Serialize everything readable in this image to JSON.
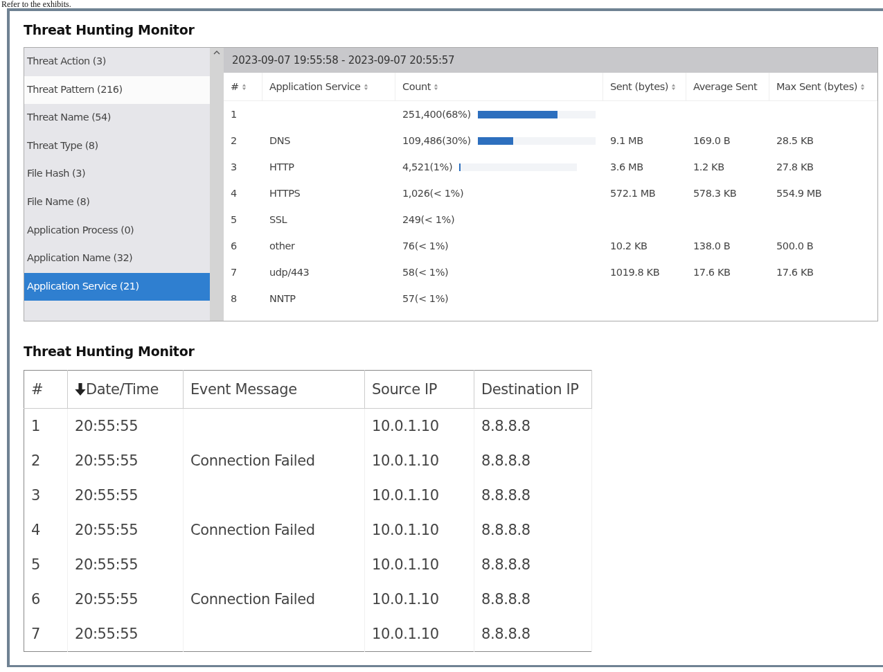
{
  "caption": "Refer to the exhibits.",
  "top_panel": {
    "title": "Threat Hunting Monitor",
    "sidebar": {
      "items": [
        {
          "label": "Threat Action (3)",
          "selected": false,
          "hovered": false
        },
        {
          "label": "Threat Pattern (216)",
          "selected": false,
          "hovered": true
        },
        {
          "label": "Threat Name (54)",
          "selected": false,
          "hovered": false
        },
        {
          "label": "Threat Type (8)",
          "selected": false,
          "hovered": false
        },
        {
          "label": "File Hash (3)",
          "selected": false,
          "hovered": false
        },
        {
          "label": "File Name (8)",
          "selected": false,
          "hovered": false
        },
        {
          "label": "Application Process (0)",
          "selected": false,
          "hovered": false
        },
        {
          "label": "Application Name (32)",
          "selected": false,
          "hovered": false
        },
        {
          "label": "Application Service (21)",
          "selected": true,
          "hovered": false
        }
      ]
    },
    "time_range": "2023-09-07 19:55:58 - 2023-09-07 20:55:57",
    "table": {
      "columns": [
        {
          "label": "#",
          "sortable": true
        },
        {
          "label": "Application Service",
          "sortable": true
        },
        {
          "label": "Count",
          "sortable": true
        },
        {
          "label": "Sent (bytes)",
          "sortable": true
        },
        {
          "label": "Average Sent",
          "sortable": false
        },
        {
          "label": "Max Sent (bytes)",
          "sortable": true
        }
      ],
      "rows": [
        {
          "num": "1",
          "service": "",
          "count": "251,400(68%)",
          "level": 0.68,
          "sent": "",
          "avg": "",
          "max": ""
        },
        {
          "num": "2",
          "service": "DNS",
          "count": "109,486(30%)",
          "level": 0.3,
          "sent": "9.1 MB",
          "avg": "169.0 B",
          "max": "28.5 KB"
        },
        {
          "num": "3",
          "service": "HTTP",
          "count": "4,521(1%)",
          "level": 0.01,
          "sent": "3.6 MB",
          "avg": "1.2 KB",
          "max": "27.8 KB"
        },
        {
          "num": "4",
          "service": "HTTPS",
          "count": "1,026(< 1%)",
          "sent": "572.1 MB",
          "avg": "578.3 KB",
          "max": "554.9 MB"
        },
        {
          "num": "5",
          "service": "SSL",
          "count": "249(< 1%)",
          "sent": "",
          "avg": "",
          "max": ""
        },
        {
          "num": "6",
          "service": "other",
          "count": "76(< 1%)",
          "sent": "10.2 KB",
          "avg": "138.0 B",
          "max": "500.0 B"
        },
        {
          "num": "7",
          "service": "udp/443",
          "count": "58(< 1%)",
          "sent": "1019.8 KB",
          "avg": "17.6 KB",
          "max": "17.6 KB"
        },
        {
          "num": "8",
          "service": "NNTP",
          "count": "57(< 1%)",
          "sent": "",
          "avg": "",
          "max": ""
        }
      ]
    }
  },
  "bottom_panel": {
    "title": "Threat Hunting Monitor",
    "table": {
      "columns": [
        {
          "label": "#",
          "sorted": false
        },
        {
          "label": "Date/Time",
          "sorted": true
        },
        {
          "label": "Event Message",
          "sorted": false
        },
        {
          "label": "Source IP",
          "sorted": false
        },
        {
          "label": "Destination IP",
          "sorted": false
        }
      ],
      "rows": [
        [
          "1",
          "20:55:55",
          "",
          "10.0.1.10",
          "8.8.8.8"
        ],
        [
          "2",
          "20:55:55",
          "Connection Failed",
          "10.0.1.10",
          "8.8.8.8"
        ],
        [
          "3",
          "20:55:55",
          "",
          "10.0.1.10",
          "8.8.8.8"
        ],
        [
          "4",
          "20:55:55",
          "Connection Failed",
          "10.0.1.10",
          "8.8.8.8"
        ],
        [
          "5",
          "20:55:55",
          "",
          "10.0.1.10",
          "8.8.8.8"
        ],
        [
          "6",
          "20:55:55",
          "Connection Failed",
          "10.0.1.10",
          "8.8.8.8"
        ],
        [
          "7",
          "20:55:55",
          "",
          "10.0.1.10",
          "8.8.8.8"
        ]
      ]
    }
  }
}
